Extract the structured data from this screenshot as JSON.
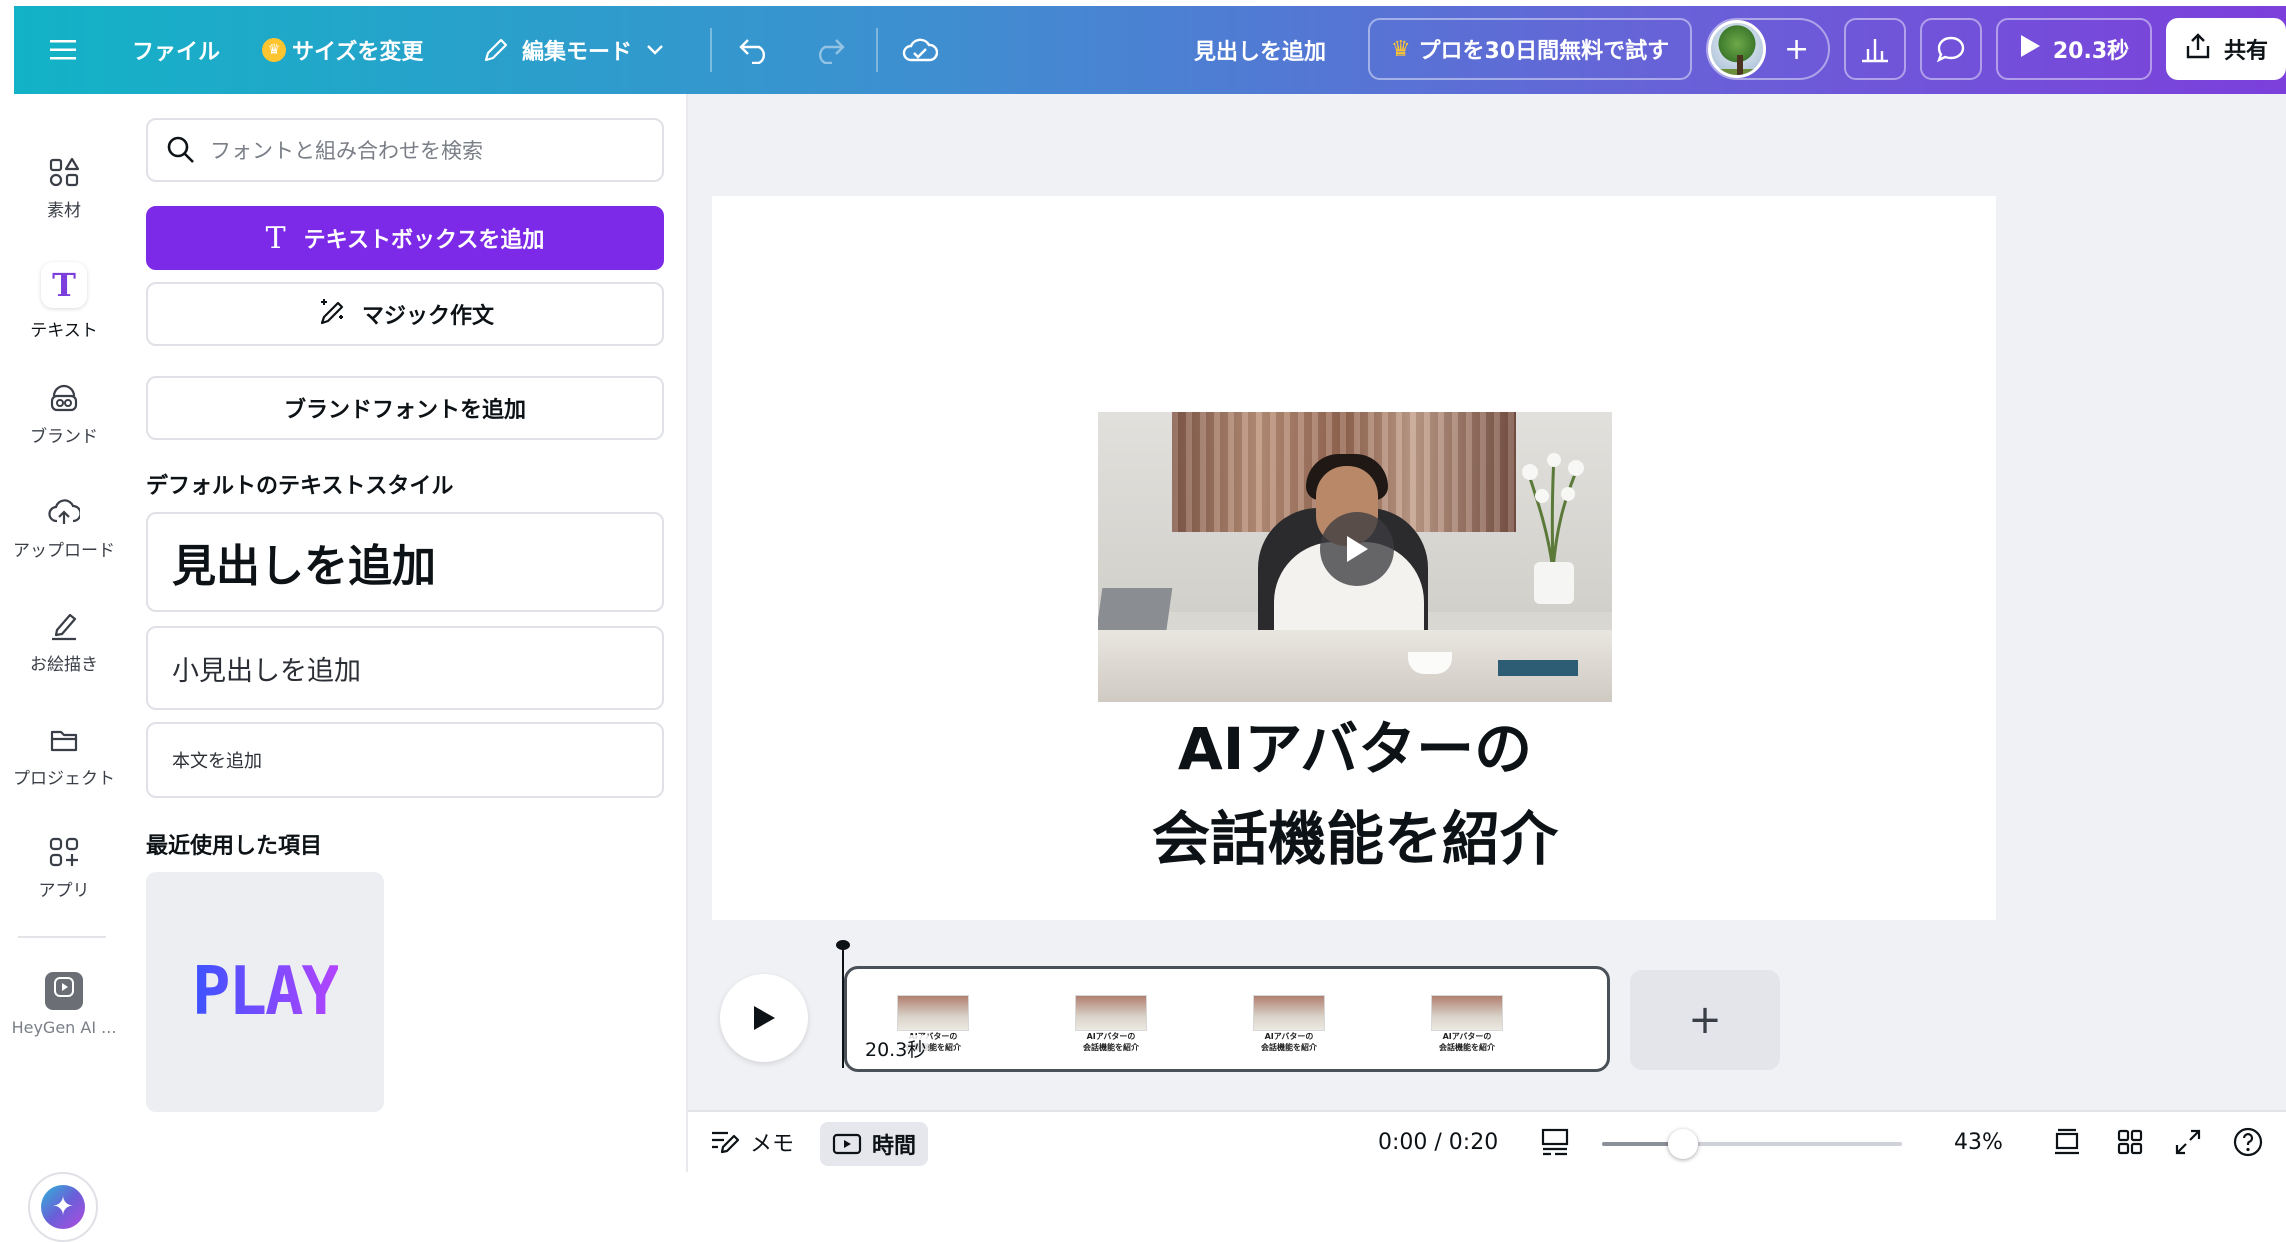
{
  "topbar": {
    "menu_icon": "hamburger-icon",
    "file_label": "ファイル",
    "resize_label": "サイズを変更",
    "edit_mode_label": "編集モード",
    "add_heading_label": "見出しを追加",
    "pro_trial_label": "プロを30日間無料で試す",
    "play_duration_label": "20.3秒",
    "share_label": "共有",
    "brand_gradient": [
      "#12b3c6",
      "#7c3fdb"
    ]
  },
  "rail": {
    "items": [
      {
        "label": "素材",
        "icon": "elements-icon"
      },
      {
        "label": "テキスト",
        "icon": "text-icon"
      },
      {
        "label": "ブランド",
        "icon": "brand-icon"
      },
      {
        "label": "アップロード",
        "icon": "upload-icon"
      },
      {
        "label": "お絵描き",
        "icon": "draw-icon"
      },
      {
        "label": "プロジェクト",
        "icon": "folder-icon"
      },
      {
        "label": "アプリ",
        "icon": "apps-icon"
      },
      {
        "label": "HeyGen AI ...",
        "icon": "heygen-icon"
      }
    ]
  },
  "panel": {
    "search_placeholder": "フォントと組み合わせを検索",
    "add_textbox_label": "テキストボックスを追加",
    "magic_write_label": "マジック作文",
    "brand_font_label": "ブランドフォントを追加",
    "default_styles_title": "デフォルトのテキストスタイル",
    "heading_label": "見出しを追加",
    "subheading_label": "小見出しを追加",
    "body_label": "本文を追加",
    "recent_title": "最近使用した項目",
    "recent_item_text": "PLAY",
    "accent_color": "#7d2ae8"
  },
  "canvas": {
    "caption_line1": "AIアバターの",
    "caption_line2": "会話機能を紹介"
  },
  "timeline": {
    "track_duration": "20.3秒",
    "thumbnails": [
      {
        "line1": "AIアバターの",
        "line2": "会話機能を紹介"
      },
      {
        "line1": "AIアバターの",
        "line2": "会話機能を紹介"
      },
      {
        "line1": "AIアバターの",
        "line2": "会話機能を紹介"
      },
      {
        "line1": "AIアバターの",
        "line2": "会話機能を紹介"
      }
    ]
  },
  "bottombar": {
    "notes_label": "メモ",
    "time_label": "時間",
    "time_readout": "0:00 / 0:20",
    "zoom_fraction": 0.43,
    "zoom_label": "43%"
  }
}
